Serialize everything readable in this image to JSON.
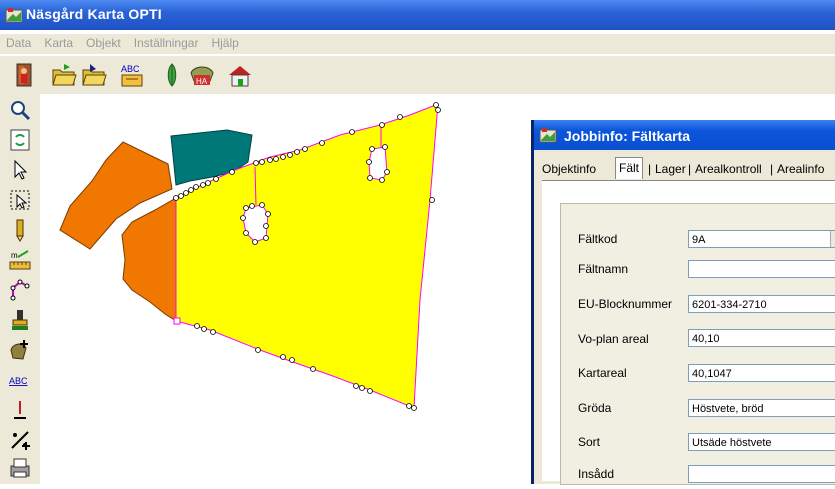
{
  "window": {
    "title": "Näsgård Karta OPTI"
  },
  "menu": {
    "items": [
      "Data",
      "Karta",
      "Objekt",
      "Inställningar",
      "Hjälp"
    ]
  },
  "toolbar": {
    "abc_label": "ABC",
    "ha_label": "HA"
  },
  "leftbar": {
    "abc_label": "ABC",
    "m_label": "m"
  },
  "dialog": {
    "title": "Jobbinfo: Fältkarta",
    "tabs": [
      "Objektinfo",
      "Fält",
      "Lager",
      "Arealkontroll",
      "Arealinfo"
    ],
    "active_tab": "Fält",
    "fields": [
      {
        "label": "Fältkod",
        "value": "9A",
        "type": "select"
      },
      {
        "label": "Fältnamn",
        "value": ""
      },
      {
        "label": "EU-Blocknummer",
        "value": "6201-334-2710"
      },
      {
        "label": "Vo-plan areal",
        "value": "40,10"
      },
      {
        "label": "Kartareal",
        "value": "40,1047"
      },
      {
        "label": "Gröda",
        "value": "Höstvete, bröd"
      },
      {
        "label": "Sort",
        "value": "Utsäde höstvete"
      },
      {
        "label": "Insådd",
        "value": ""
      }
    ]
  },
  "colors": {
    "field_selected": "#ffff00",
    "field_orange": "#f07800",
    "field_teal": "#007878",
    "outline": "#ff00ff"
  }
}
